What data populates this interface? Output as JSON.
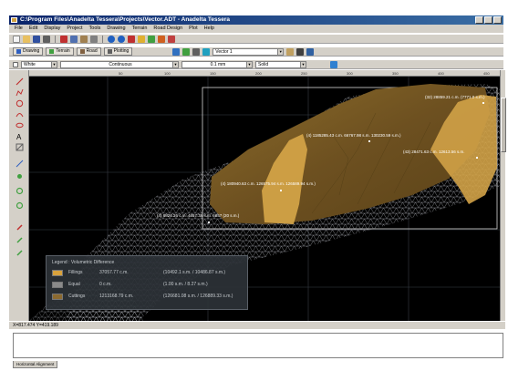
{
  "window": {
    "title": "C:\\Program Files\\Anadelta Tessera\\Projects\\Vector.ADT - Anadelta Tessera"
  },
  "menu": {
    "items": [
      "File",
      "Edit",
      "Display",
      "Project",
      "Tools",
      "Drawing",
      "Terrain",
      "Road Design",
      "Plot",
      "Help"
    ]
  },
  "tabs": [
    {
      "label": "Drawing",
      "icon": "drawing-icon"
    },
    {
      "label": "Terrain",
      "icon": "terrain-icon"
    },
    {
      "label": "Road",
      "icon": "road-icon"
    },
    {
      "label": "Plotting",
      "icon": "plotting-icon"
    }
  ],
  "layer_select": {
    "value": "Vector 1"
  },
  "props": {
    "color": "White",
    "linetype": "Continuous",
    "lineweight": "0.1 mm",
    "style": "Solid"
  },
  "ruler": {
    "marks": [
      "50",
      "100",
      "150",
      "200",
      "250",
      "300",
      "350",
      "400",
      "450"
    ]
  },
  "status": {
    "coords": "X=817.474  Y=419.189"
  },
  "bottom_tab": "Horizontal Alignment",
  "legend": {
    "title": "Legend : Volumetric Difference",
    "rows": [
      {
        "label": "Fillings",
        "v1": "37057.77 c.m.",
        "v2": "(10492.1 s.m. / 10486.87 s.m.)",
        "color": "#d9a23c"
      },
      {
        "label": "Equal",
        "v1": "0 c.m.",
        "v2": "(1.00 s.m. / 8.27 s.m.)",
        "color": "#8a8a8a"
      },
      {
        "label": "Cuttings",
        "v1": "1213168.79 c.m.",
        "v2": "(126681.08 s.m. / 126889.33 s.m.)",
        "color": "#8c6a30"
      }
    ]
  },
  "annotations": [
    {
      "text": "(32) 28859.21 c.m. (7771.0 s.m.)"
    },
    {
      "text": "(4) 1185285.43 c.m. 66767.98 s.m. 130230.59 s.m.)"
    },
    {
      "text": "(43) 28471.63 c.m. 12613.56 s.m."
    },
    {
      "text": "(4) 180940.63 c.m. 126575.94 s.m. 126589.94 s.m.)"
    },
    {
      "text": "(4) 8826.26 c.m. 4657.36 s.m. 6657 (20 s.m.)"
    }
  ],
  "colors": {
    "cut_surface": "#7d5d22",
    "fill_surface": "#d2a247",
    "mesh": "#c8ccd4",
    "grid": "#3a3f46"
  }
}
